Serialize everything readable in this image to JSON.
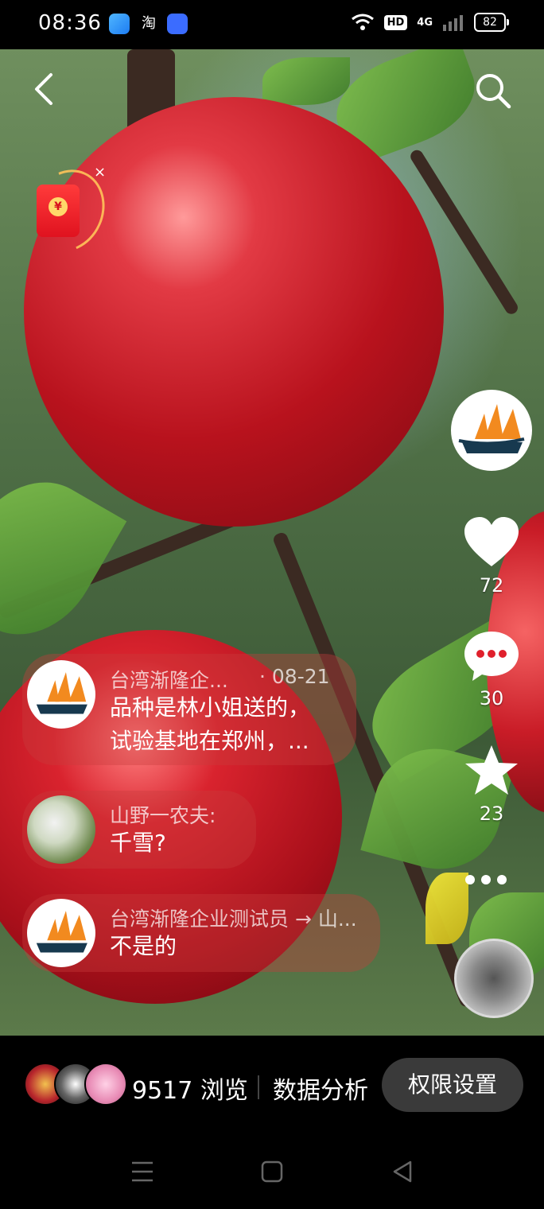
{
  "status_bar": {
    "time": "08:36",
    "apps": [
      "app-icon-blue",
      "taobao-icon",
      "chat-icon"
    ],
    "taobao_label": "淘",
    "hd_label": "HD",
    "network_label": "4G",
    "battery": "82"
  },
  "header": {
    "back_icon": "back-chevron-icon",
    "search_icon": "search-icon"
  },
  "red_packet": {
    "coin_symbol": "¥",
    "close_symbol": "×"
  },
  "actions": {
    "like_count": "72",
    "comment_count": "30",
    "favorite_count": "23"
  },
  "comments": [
    {
      "author": "台湾渐隆企...",
      "date": "· 08-21",
      "lines": [
        "品种是林小姐送的，",
        "试验基地在郑州，..."
      ]
    },
    {
      "author": "山野一农夫:",
      "lines": [
        "千雪?"
      ]
    },
    {
      "author": "台湾渐隆企业测试员 → 山...",
      "lines": [
        "不是的"
      ]
    }
  ],
  "bottom_bar": {
    "views": "9517 浏览",
    "analysis_label": "数据分析",
    "permission_button": "权限设置"
  },
  "colors": {
    "accent_orange": "#f28a1f",
    "logo_navy": "#17394f",
    "bubble": "#c83c3c"
  }
}
